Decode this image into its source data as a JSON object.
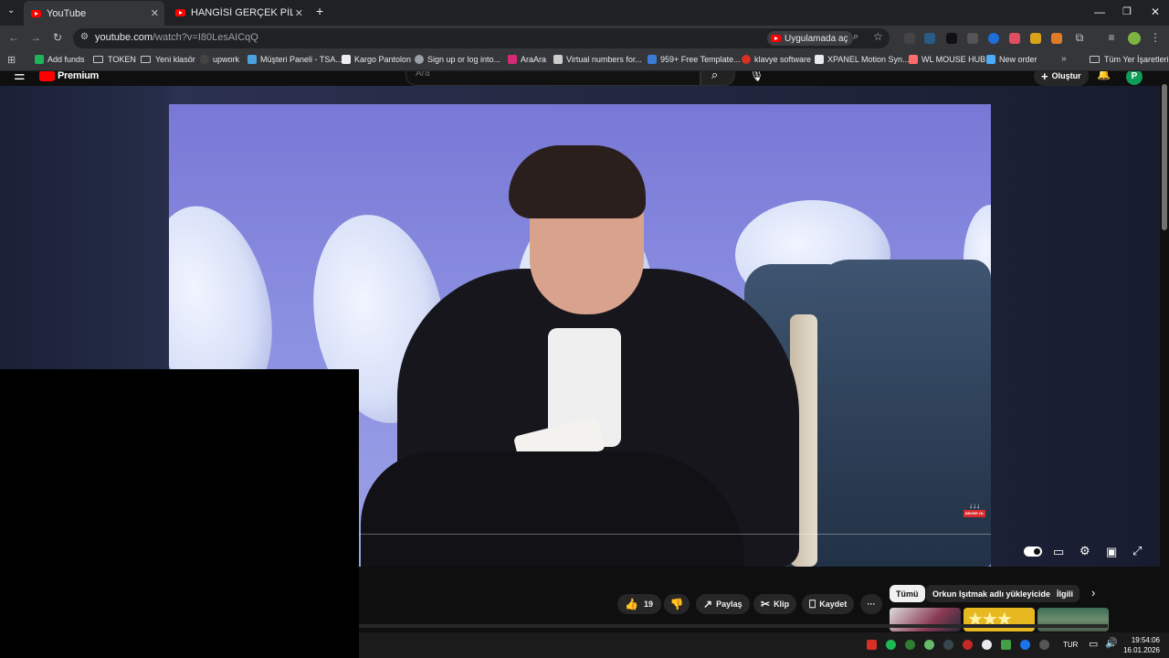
{
  "browser": {
    "tabs": [
      {
        "title": "YouTube",
        "active": true
      },
      {
        "title": "HANGİSİ GERÇEK PİLOT?! ft. @",
        "active": false
      }
    ],
    "new_tab": "+",
    "window_controls": {
      "minimize": "—",
      "restore": "❐",
      "close": "✕"
    },
    "url_host": "youtube.com",
    "url_path": "/watch?v=I80LesAICqQ",
    "open_in_app": "Uygulamada aç",
    "bookmarks": [
      {
        "label": "Add funds",
        "icon": "green",
        "color": "#1fb35a"
      },
      {
        "label": "TOKEN",
        "icon": "folder"
      },
      {
        "label": "Yeni klasör",
        "icon": "folder"
      },
      {
        "label": "upwork",
        "icon": "round",
        "color": "#6fda44"
      },
      {
        "label": "Müşteri Paneli - TSA...",
        "icon": "wave",
        "color": "#4aa3df"
      },
      {
        "label": "Kargo Pantolon",
        "icon": "square",
        "color": "#222222"
      },
      {
        "label": "Sign up or log into...",
        "icon": "round",
        "color": "#9aa0a6"
      },
      {
        "label": "AraAra",
        "icon": "square",
        "color": "#d62976"
      },
      {
        "label": "Virtual numbers for...",
        "icon": "square",
        "color": "#cccccc"
      },
      {
        "label": "959+ Free Template...",
        "icon": "square",
        "color": "#3a7bd5"
      },
      {
        "label": "klavye software",
        "icon": "round",
        "color": "#d93025"
      },
      {
        "label": "XPANEL Motion Syn...",
        "icon": "square",
        "color": "#e8eaed"
      },
      {
        "label": "WL MOUSE HUB",
        "icon": "square",
        "color": "#ff6b6b"
      },
      {
        "label": "New order",
        "icon": "square",
        "color": "#4dabf7"
      }
    ],
    "bookmarks_more": "»",
    "all_bookmarks": "Tüm Yer İşaretleri"
  },
  "youtube": {
    "logo_text": "Premium",
    "search_placeholder": "Ara",
    "create_label": "Oluştur",
    "avatar_letter": "P",
    "like_count": "19",
    "share_label": "Paylaş",
    "clip_label": "Klip",
    "save_label": "Kaydet",
    "more_label": "···",
    "chips": [
      "Tümü",
      "Orkun Işıtmak adlı yükleyiciden",
      "İlgili"
    ],
    "subscribe_badge": "ABONE OL",
    "autoplay": "on"
  },
  "taskbar": {
    "language": "TUR",
    "time": "19:54:06",
    "date": "16.01.2026"
  }
}
